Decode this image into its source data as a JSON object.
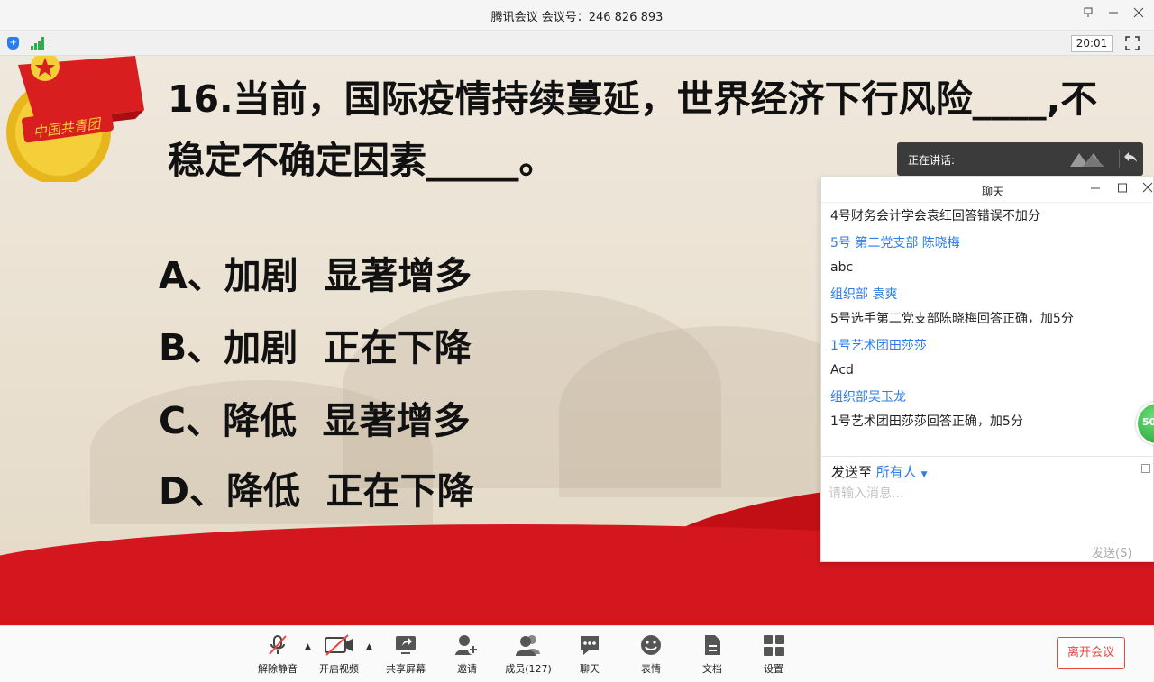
{
  "window": {
    "title": "腾讯会议 会议号：246 826 893"
  },
  "status": {
    "time": "20:01"
  },
  "slide": {
    "question_line1": "16.当前，国际疫情持续蔓延，世界经济下行风险____,不",
    "question_line2": "稳定不确定因素_____。",
    "options": [
      "A、加剧  显著增多",
      "B、加剧  正在下降",
      "C、降低  显著增多",
      "D、降低  正在下降"
    ],
    "emblem_text": "中国共青团"
  },
  "speaking": {
    "label": "正在讲话:"
  },
  "chat": {
    "title": "聊天",
    "messages": [
      {
        "text": "4号财务会计学会袁红回答错误不加分",
        "type": "text"
      },
      {
        "text": "5号  第二党支部 陈晓梅",
        "type": "sender"
      },
      {
        "text": "abc",
        "type": "text"
      },
      {
        "text": "组织部 袁爽",
        "type": "sender"
      },
      {
        "text": "5号选手第二党支部陈晓梅回答正确，加5分",
        "type": "text"
      },
      {
        "text": "1号艺术团田莎莎",
        "type": "sender"
      },
      {
        "text": "Acd",
        "type": "text"
      },
      {
        "text": "组织部吴玉龙",
        "type": "sender"
      },
      {
        "text": "1号艺术团田莎莎回答正确，加5分",
        "type": "text"
      }
    ],
    "send_to_label": "发送至",
    "send_to_target": "所有人",
    "input_placeholder": "请输入消息...",
    "send_button": "发送(S)"
  },
  "badge": {
    "text": "50"
  },
  "toolbar": {
    "unmute": "解除静音",
    "start_video": "开启视频",
    "share_screen": "共享屏幕",
    "invite": "邀请",
    "members": "成员(127)",
    "chat": "聊天",
    "emoji": "表情",
    "docs": "文档",
    "settings": "设置",
    "leave": "离开会议"
  },
  "colors": {
    "accent_blue": "#2b7de9",
    "leave_red": "#e94545",
    "slide_red": "#d4171e"
  }
}
